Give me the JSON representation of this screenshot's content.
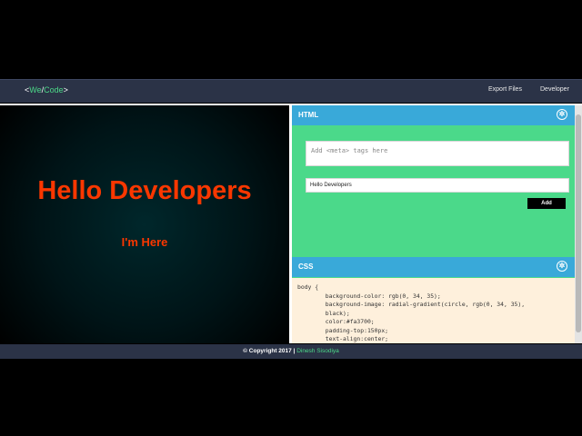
{
  "brand": {
    "lt": "<",
    "we": "We",
    "slash": "/",
    "code": "Code",
    "gt": ">"
  },
  "nav": {
    "export_files": "Export Files",
    "developer": "Developer"
  },
  "preview": {
    "heading": "Hello Developers",
    "subheading": "I'm Here"
  },
  "html_panel": {
    "title": "HTML",
    "meta_placeholder": "Add <meta> tags here",
    "text_value": "Hello Developers",
    "add_label": "Add"
  },
  "css_panel": {
    "title": "CSS",
    "code": "body {\n        background-color: rgb(0, 34, 35);\n        background-image: radial-gradient(circle, rgb(0, 34, 35),\n        black);\n        color:#fa3700;\n        padding-top:150px;\n        text-align:center;"
  },
  "footer": {
    "copyright": "© Copyright 2017 | ",
    "author": "Dinesh Sisodiya"
  },
  "colors": {
    "navbar": "#2b3347",
    "accent_green": "#4cd988",
    "panel_blue": "#39a9d9",
    "editor_green": "#4bd98a",
    "text_orange": "#fa3700",
    "css_bg": "#fef0dc"
  },
  "icons": {
    "panel_settings": "gear-icon"
  }
}
